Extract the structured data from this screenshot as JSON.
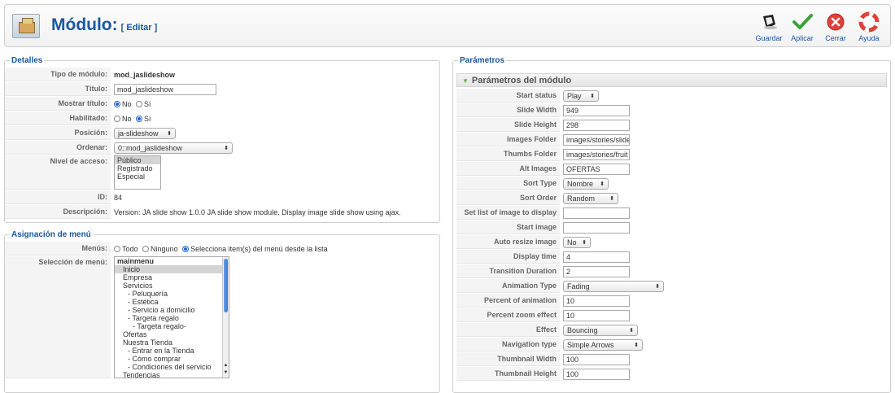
{
  "header": {
    "title": "Módulo:",
    "subtitle": "[ Editar ]"
  },
  "toolbar": {
    "save": "Guardar",
    "apply": "Aplicar",
    "close": "Cerrar",
    "help": "Ayuda"
  },
  "details": {
    "legend": "Detalles",
    "tipo_label": "Tipo de módulo:",
    "tipo_value": "mod_jaslideshow",
    "titulo_label": "Título:",
    "titulo_value": "mod_jaslideshow",
    "mostrar_label": "Mostrar título:",
    "no": "No",
    "si": "Sí",
    "habilitado_label": "Habilitado:",
    "posicion_label": "Posición:",
    "posicion_value": "ja-slideshow",
    "ordenar_label": "Ordenar:",
    "ordenar_value": "0::mod_jaslideshow",
    "nivel_label": "Nivel de acceso:",
    "nivel_options": [
      "Público",
      "Registrado",
      "Especial"
    ],
    "id_label": "ID:",
    "id_value": "84",
    "desc_label": "Descripción:",
    "desc_value": "Version: JA slide show 1.0.0 JA slide show module. Display image slide show using ajax."
  },
  "menu": {
    "legend": "Asignación de menú",
    "menus_label": "Menús:",
    "opt_todo": "Todo",
    "opt_ninguno": "Ninguno",
    "opt_lista": "Selecciona item(s) del menú desde la lista",
    "seleccion_label": "Selección de menú:",
    "items": [
      "mainmenu",
      "Inicio",
      "Empresa",
      "Servicios",
      "- Peluquería",
      "- Estética",
      "- Servicio a domicilio",
      "- Targeta regalo",
      "- Targeta regalo-",
      "Ofertas",
      "Nuestra Tienda",
      "- Entrar en la Tienda",
      "- Cómo comprar",
      "- Condiciones del servicio",
      "Tendencias"
    ]
  },
  "params": {
    "legend": "Parámetros",
    "pane_title": "Parámetros del módulo",
    "start_status_label": "Start status",
    "start_status_value": "Play",
    "slide_width_label": "Slide Width",
    "slide_width_value": "949",
    "slide_height_label": "Slide Height",
    "slide_height_value": "298",
    "images_folder_label": "Images Folder",
    "images_folder_value": "images/stories/slide",
    "thumbs_folder_label": "Thumbs Folder",
    "thumbs_folder_value": "images/stories/fruit",
    "alt_images_label": "Alt Images",
    "alt_images_value": "OFERTAS",
    "sort_type_label": "Sort Type",
    "sort_type_value": "Nombre",
    "sort_order_label": "Sort Order",
    "sort_order_value": "Random",
    "set_list_label": "Set list of image to display",
    "set_list_value": "",
    "start_image_label": "Start image",
    "start_image_value": "",
    "auto_resize_label": "Auto resize image",
    "auto_resize_value": "No",
    "display_time_label": "Display time",
    "display_time_value": "4",
    "transition_label": "Transition Duration",
    "transition_value": "2",
    "animation_type_label": "Animation Type",
    "animation_type_value": "Fading",
    "percent_anim_label": "Percent of animation",
    "percent_anim_value": "10",
    "percent_zoom_label": "Percent zoom effect",
    "percent_zoom_value": "10",
    "effect_label": "Effect",
    "effect_value": "Bouncing",
    "nav_type_label": "Navigation type",
    "nav_type_value": "Simple Arrows",
    "thumb_width_label": "Thumbnail Width",
    "thumb_width_value": "100",
    "thumb_height_label": "Thumbnail Height",
    "thumb_height_value": "100"
  }
}
